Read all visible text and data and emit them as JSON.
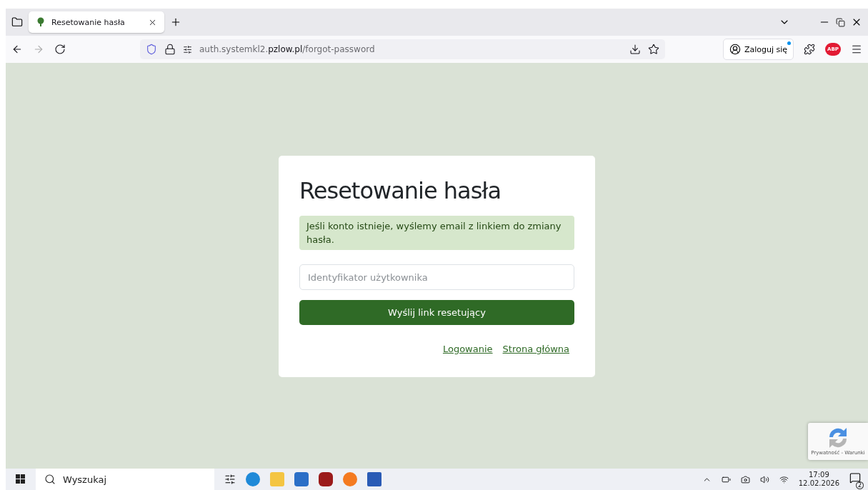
{
  "browser": {
    "tabs": [
      {
        "title": "Resetowanie hasła",
        "selected": true
      }
    ],
    "url": {
      "prefix": "auth.systemkl2.",
      "domain": "pzlow.pl",
      "path": "/forgot-password"
    },
    "account_button": "Zaloguj się",
    "abp_badge": "ABP"
  },
  "card": {
    "title": "Resetowanie hasła",
    "alert": "Jeśli konto istnieje, wyślemy email z linkiem do zmiany hasła.",
    "field": {
      "placeholder": "Identyfikator użytkownika"
    },
    "submit": "Wyślij link resetujący",
    "links": [
      "Logowanie",
      "Strona główna"
    ]
  },
  "recaptcha": {
    "caption": "Prywatność - Warunki"
  },
  "taskbar": {
    "search_placeholder": "Wyszukaj",
    "time": "17:09",
    "date": "12.02.2026",
    "notifications": "2"
  }
}
